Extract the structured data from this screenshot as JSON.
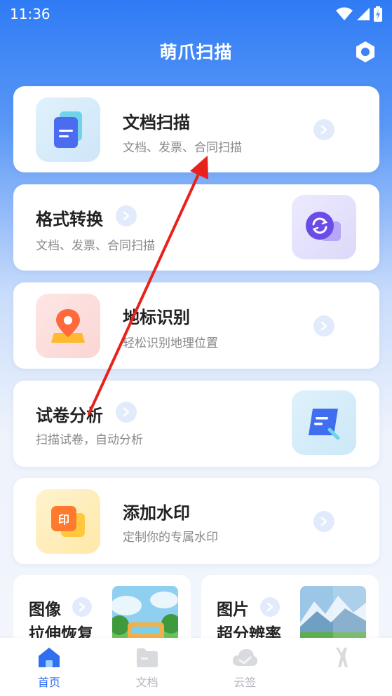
{
  "status": {
    "time": "11:36"
  },
  "header": {
    "title": "萌爪扫描"
  },
  "cards": [
    {
      "title": "文档扫描",
      "subtitle": "文档、发票、合同扫描"
    },
    {
      "title": "格式转换",
      "subtitle": "文档、发票、合同扫描"
    },
    {
      "title": "地标识别",
      "subtitle": "轻松识别地理位置"
    },
    {
      "title": "试卷分析",
      "subtitle": "扫描试卷，自动分析"
    },
    {
      "title": "添加水印",
      "subtitle": "定制你的专属水印"
    }
  ],
  "small_cards": [
    {
      "line1": "图像",
      "line2": "拉伸恢复"
    },
    {
      "line1": "图片",
      "line2": "超分辨率"
    }
  ],
  "tabs": [
    {
      "label": "首页",
      "icon": "home-icon",
      "active": true
    },
    {
      "label": "文档",
      "icon": "folder-icon",
      "active": false
    },
    {
      "label": "云签",
      "icon": "cloud-icon",
      "active": false
    },
    {
      "label": "",
      "icon": "profile-icon",
      "active": false
    }
  ],
  "colors": {
    "accent": "#2f6ff0",
    "inactive": "#b5b8be",
    "annotation": "#e8221b"
  }
}
